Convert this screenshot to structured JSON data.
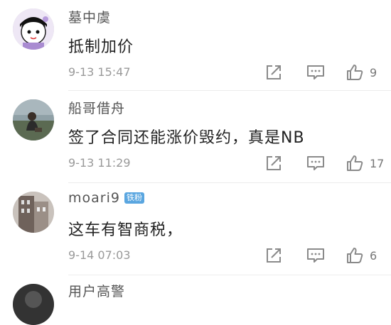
{
  "comments": [
    {
      "username": "墓中虞",
      "badge": "",
      "text": "抵制加价",
      "time": "9-13 15:47",
      "likes": "9",
      "avatar": "cartoon-girl-avatar",
      "avatar_bg": "#d8c7ea"
    },
    {
      "username": "船哥借舟",
      "badge": "",
      "text": "签了合同还能涨价毁约，真是NB",
      "time": "9-13 11:29",
      "likes": "17",
      "avatar": "photo-person-avatar",
      "avatar_bg": "#6f7a6a"
    },
    {
      "username": "moari9",
      "badge": "铁粉",
      "text": "这车有智商税，",
      "time": "9-14 07:03",
      "likes": "6",
      "avatar": "building-photo-avatar",
      "avatar_bg": "#8b7d76"
    },
    {
      "username": "用户高警",
      "avatar": "dark-photo-avatar",
      "avatar_bg": "#333333"
    }
  ],
  "icons": {
    "share": "share-edit-icon",
    "reply": "comment-icon",
    "like": "thumbs-up-icon"
  },
  "colors": {
    "badge": "#5aa6e0",
    "icon": "#8a8a8a"
  }
}
